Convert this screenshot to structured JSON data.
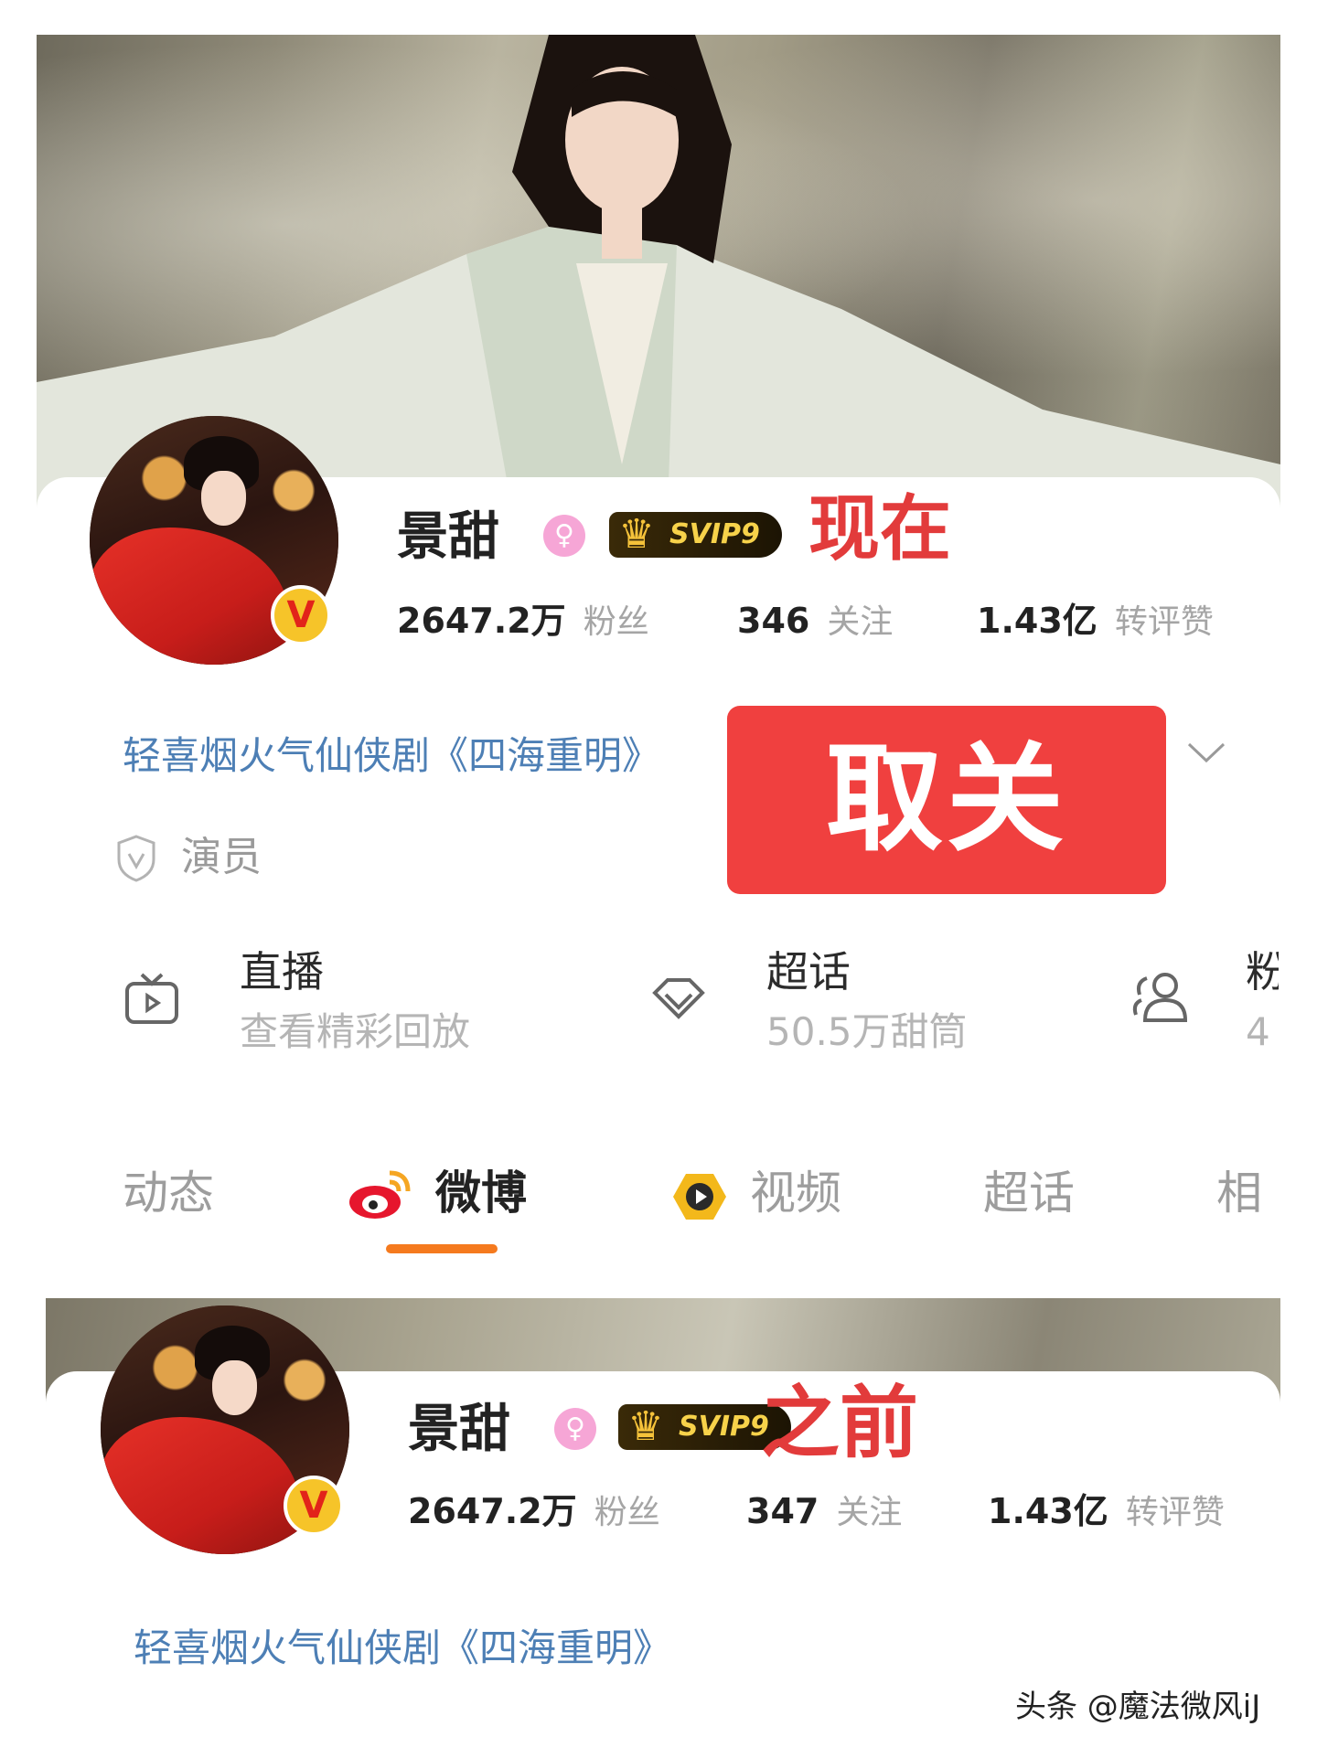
{
  "profile_current": {
    "name": "景甜",
    "gender_icon": "female-icon",
    "svip_label": "SVIP9",
    "status_label": "现在",
    "stats": [
      {
        "value": "2647.2万",
        "label": "粉丝"
      },
      {
        "value": "346",
        "label": "关注"
      },
      {
        "value": "1.43亿",
        "label": "转评赞"
      }
    ],
    "bio_link": "轻喜烟火气仙侠剧《四海重明》",
    "verification": "演员",
    "unfollow_button": "取关"
  },
  "features": [
    {
      "icon": "tv-icon",
      "title": "直播",
      "subtitle": "查看精彩回放"
    },
    {
      "icon": "diamond-icon",
      "title": "超话",
      "subtitle": "50.5万甜筒"
    },
    {
      "icon": "fans-group-icon",
      "title": "粉",
      "subtitle": "4"
    }
  ],
  "tabs": [
    {
      "label": "动态",
      "icon": null,
      "active": false
    },
    {
      "label": "微博",
      "icon": "weibo-icon",
      "active": true
    },
    {
      "label": "视频",
      "icon": "video-icon",
      "active": false
    },
    {
      "label": "超话",
      "icon": null,
      "active": false
    },
    {
      "label": "相",
      "icon": null,
      "active": false
    }
  ],
  "profile_before": {
    "name": "景甜",
    "svip_label": "SVIP9",
    "status_label": "之前",
    "stats": [
      {
        "value": "2647.2万",
        "label": "粉丝"
      },
      {
        "value": "347",
        "label": "关注"
      },
      {
        "value": "1.43亿",
        "label": "转评赞"
      }
    ],
    "bio_link": "轻喜烟火气仙侠剧《四海重明》"
  },
  "watermark": "头条 @魔法微风iJ",
  "colors": {
    "accent": "#f57a1e",
    "unfollow": "#f0403f",
    "link": "#4d7fb5",
    "label_red": "#e23b3b"
  }
}
